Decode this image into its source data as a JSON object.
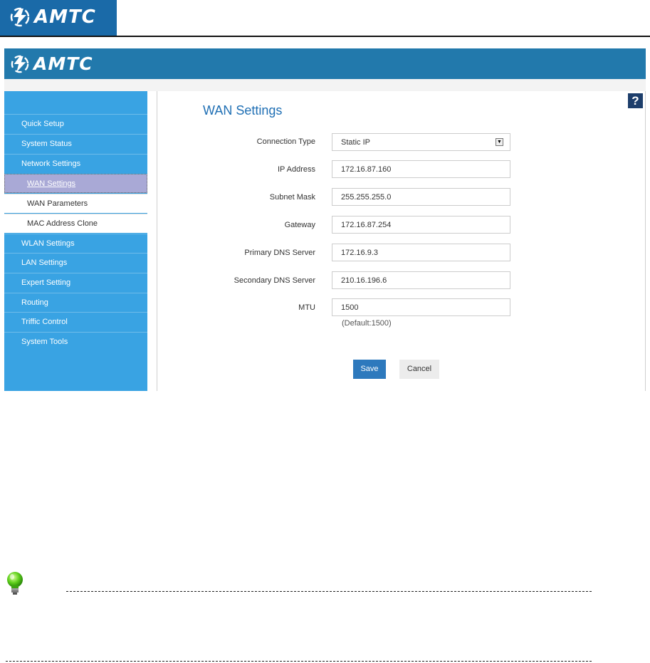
{
  "document": {
    "logo_text": "AMTC"
  },
  "app": {
    "logo_text": "AMTC",
    "help_label": "?"
  },
  "sidebar": {
    "items": [
      {
        "label": "Quick Setup"
      },
      {
        "label": "System Status"
      },
      {
        "label": "Network Settings"
      },
      {
        "label": "WAN Settings",
        "active": true
      },
      {
        "label": "WAN Parameters"
      },
      {
        "label": "MAC Address Clone"
      },
      {
        "label": "WLAN Settings"
      },
      {
        "label": "LAN Settings"
      },
      {
        "label": "Expert Setting"
      },
      {
        "label": "Routing"
      },
      {
        "label": "Triffic Control"
      },
      {
        "label": "System Tools"
      }
    ]
  },
  "form": {
    "title": "WAN Settings",
    "connection_type": {
      "label": "Connection Type",
      "value": "Static IP"
    },
    "ip_address": {
      "label": "IP Address",
      "value": "172.16.87.160"
    },
    "subnet_mask": {
      "label": "Subnet Mask",
      "value": "255.255.255.0"
    },
    "gateway": {
      "label": "Gateway",
      "value": "172.16.87.254"
    },
    "primary_dns": {
      "label": "Primary DNS Server",
      "value": "172.16.9.3"
    },
    "secondary_dns": {
      "label": "Secondary DNS Server",
      "value": "210.16.196.6"
    },
    "mtu": {
      "label": "MTU",
      "value": "1500",
      "hint": "(Default:1500)"
    },
    "save_label": "Save",
    "cancel_label": "Cancel"
  },
  "colors": {
    "header_blue": "#2279ac",
    "sidebar_blue": "#39a3e3",
    "active_item": "#a9a9d6",
    "title_blue": "#1f6fb4",
    "save_button": "#2d79bd"
  },
  "icons": {
    "help": "question-mark-icon",
    "note": "lightbulb-icon",
    "select": "dropdown-arrow-icon"
  }
}
